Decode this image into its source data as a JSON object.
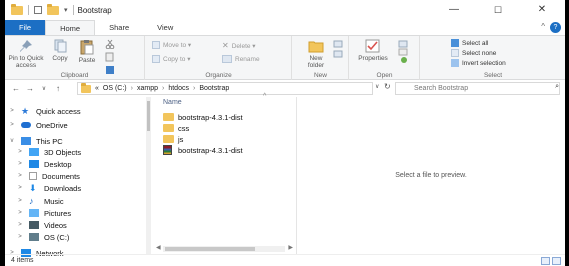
{
  "window": {
    "title": "Bootstrap",
    "controls": {
      "minimize": "—",
      "maximize": "☐",
      "close": "✕"
    }
  },
  "ribbon_tabs": [
    "File",
    "Home",
    "Share",
    "View"
  ],
  "ribbon": {
    "clipboard": {
      "pin": "Pin to Quick access",
      "copy": "Copy",
      "paste": "Paste",
      "label": "Clipboard"
    },
    "organize": {
      "move_to": "Move to ▾",
      "copy_to": "Copy to ▾",
      "delete": "Delete ▾",
      "rename": "Rename",
      "label": "Organize"
    },
    "new": {
      "new_folder": "New folder",
      "label": "New"
    },
    "open": {
      "properties": "Properties",
      "label": "Open"
    },
    "select": {
      "select_all": "Select all",
      "select_none": "Select none",
      "invert": "Invert selection",
      "label": "Select"
    }
  },
  "address": {
    "prefix": "«",
    "crumbs": [
      "OS (C:)",
      "xampp",
      "htdocs",
      "Bootstrap"
    ],
    "search_placeholder": "Search Bootstrap"
  },
  "nav": [
    {
      "label": "Quick access",
      "icon": "star-icon",
      "color": "#2b79d8",
      "indent": 0,
      "expander": ">"
    },
    {
      "label": "OneDrive",
      "icon": "cloud-icon",
      "color": "#1f6fd1",
      "indent": 0,
      "expander": ">"
    },
    {
      "label": "This PC",
      "icon": "computer-icon",
      "color": "#3a8ee6",
      "indent": 0,
      "expander": "v"
    },
    {
      "label": "3D Objects",
      "icon": "cube-icon",
      "color": "#42a5f5",
      "indent": 1,
      "expander": ">"
    },
    {
      "label": "Desktop",
      "icon": "desktop-icon",
      "color": "#1e88e5",
      "indent": 1,
      "expander": ">"
    },
    {
      "label": "Documents",
      "icon": "document-icon",
      "color": "#9e9e9e",
      "indent": 1,
      "expander": ">"
    },
    {
      "label": "Downloads",
      "icon": "download-icon",
      "color": "#1e88e5",
      "indent": 1,
      "expander": ">"
    },
    {
      "label": "Music",
      "icon": "music-icon",
      "color": "#1565c0",
      "indent": 1,
      "expander": ">"
    },
    {
      "label": "Pictures",
      "icon": "picture-icon",
      "color": "#64b5f6",
      "indent": 1,
      "expander": ">"
    },
    {
      "label": "Videos",
      "icon": "video-icon",
      "color": "#455a64",
      "indent": 1,
      "expander": ">"
    },
    {
      "label": "OS (C:)",
      "icon": "drive-icon",
      "color": "#607d8b",
      "indent": 1,
      "expander": ">"
    },
    {
      "label": "Network",
      "icon": "network-icon",
      "color": "#1e88e5",
      "indent": 0,
      "expander": ">"
    }
  ],
  "files": {
    "column": "Name",
    "items": [
      {
        "name": "bootstrap-4.3.1-dist",
        "type": "folder"
      },
      {
        "name": "css",
        "type": "folder"
      },
      {
        "name": "js",
        "type": "folder"
      },
      {
        "name": "bootstrap-4.3.1-dist",
        "type": "zip"
      }
    ]
  },
  "preview_text": "Select a file to preview.",
  "status": "4 items"
}
